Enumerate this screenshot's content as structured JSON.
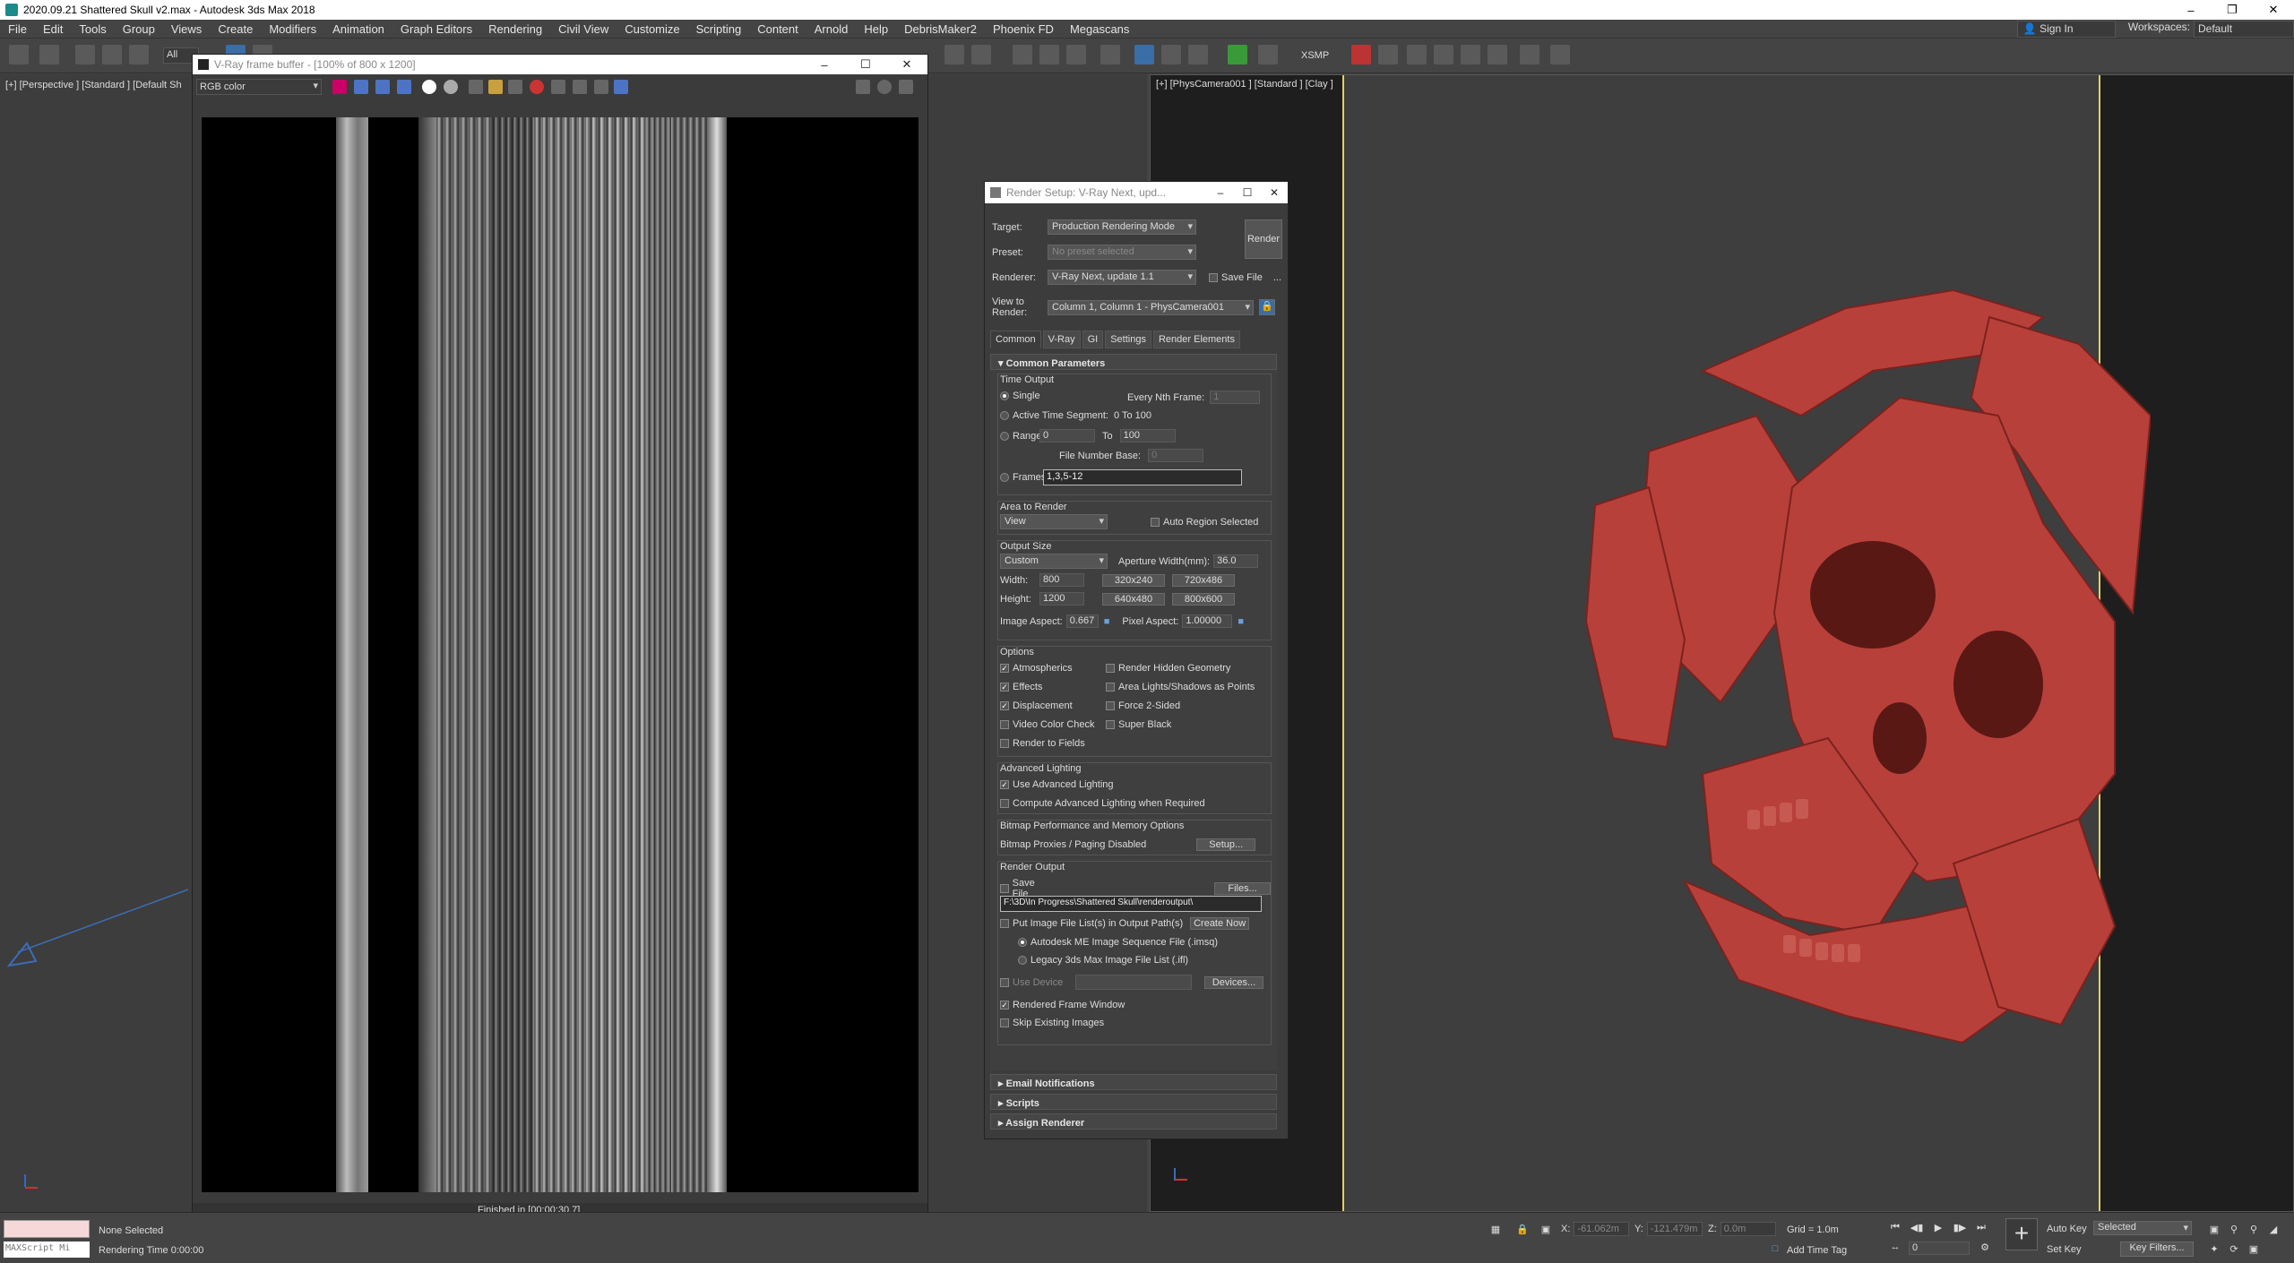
{
  "window": {
    "title": "2020.09.21 Shattered Skull v2.max - Autodesk 3ds Max 2018"
  },
  "menu": [
    "File",
    "Edit",
    "Tools",
    "Group",
    "Views",
    "Create",
    "Modifiers",
    "Animation",
    "Graph Editors",
    "Rendering",
    "Civil View",
    "Customize",
    "Scripting",
    "Content",
    "Arnold",
    "Help",
    "DebrisMaker2",
    "Phoenix FD",
    "Megascans"
  ],
  "account": {
    "signin": "Sign In",
    "workspaces_label": "Workspaces:",
    "workspaces_value": "Default"
  },
  "toolbar": {
    "selection_filter": "All",
    "xsmp": "XSMP"
  },
  "viewports": {
    "left_label": "[+] [Perspective ] [Standard ] [Default Sh",
    "right_label": "[+] [PhysCamera001 ] [Standard ] [Clay ]"
  },
  "vfb": {
    "title": "V-Ray frame buffer - [100% of 800 x 1200]",
    "channel": "RGB color",
    "status": "Finished in [00:00:30.7]"
  },
  "render_setup": {
    "title": "Render Setup: V-Ray Next, upd...",
    "target_label": "Target:",
    "target_value": "Production Rendering Mode",
    "preset_label": "Preset:",
    "preset_value": "No preset selected",
    "renderer_label": "Renderer:",
    "renderer_value": "V-Ray Next, update 1.1",
    "save_file": "Save File",
    "more": "...",
    "view_label": "View to\nRender:",
    "view_value": "Column 1, Column 1 - PhysCamera001",
    "render_button": "Render",
    "tabs": [
      "Common",
      "V-Ray",
      "GI",
      "Settings",
      "Render Elements"
    ],
    "common_params": "Common Parameters",
    "time_output": "Time Output",
    "single": "Single",
    "every_nth": "Every Nth Frame:",
    "every_nth_value": "1",
    "active_segment": "Active Time Segment:",
    "active_segment_value": "0 To 100",
    "range": "Range:",
    "range_from": "0",
    "range_to_label": "To",
    "range_to": "100",
    "file_number_base": "File Number Base:",
    "file_number_base_value": "0",
    "frames": "Frames",
    "frames_value": "1,3,5-12",
    "area_to_render": "Area to Render",
    "area_value": "View",
    "auto_region": "Auto Region Selected",
    "output_size": "Output Size",
    "output_preset": "Custom",
    "aperture_label": "Aperture Width(mm):",
    "aperture_value": "36.0",
    "width_label": "Width:",
    "width_value": "800",
    "height_label": "Height:",
    "height_value": "1200",
    "size_presets": [
      "320x240",
      "720x486",
      "640x480",
      "800x600"
    ],
    "image_aspect_label": "Image Aspect:",
    "image_aspect_value": "0.667",
    "pixel_aspect_label": "Pixel Aspect:",
    "pixel_aspect_value": "1.00000",
    "options": "Options",
    "opt_atmospherics": "Atmospherics",
    "opt_render_hidden": "Render Hidden Geometry",
    "opt_effects": "Effects",
    "opt_area_lights": "Area Lights/Shadows as Points",
    "opt_displacement": "Displacement",
    "opt_force2": "Force 2-Sided",
    "opt_video_color": "Video Color Check",
    "opt_super_black": "Super Black",
    "opt_render_fields": "Render to Fields",
    "adv_lighting": "Advanced Lighting",
    "use_adv_lighting": "Use Advanced Lighting",
    "compute_adv_lighting": "Compute Advanced Lighting when Required",
    "bitmap_perf": "Bitmap Performance and Memory Options",
    "bitmap_proxies": "Bitmap Proxies / Paging Disabled",
    "setup_button": "Setup...",
    "render_output": "Render Output",
    "ro_save_file": "Save File",
    "files_button": "Files...",
    "output_path": "F:\\3D\\In Progress\\Shattered Skull\\renderoutput\\",
    "put_image_list": "Put Image File List(s) in Output Path(s)",
    "create_now": "Create Now",
    "imsq": "Autodesk ME Image Sequence File (.imsq)",
    "ifl": "Legacy 3ds Max Image File List (.ifl)",
    "use_device": "Use Device",
    "devices_button": "Devices...",
    "rendered_frame_window": "Rendered Frame Window",
    "skip_existing": "Skip Existing Images",
    "email": "Email Notifications",
    "scripts": "Scripts",
    "assign_renderer": "Assign Renderer"
  },
  "status": {
    "maxscript": "MAXScript Mi",
    "selection": "None Selected",
    "rendering_time": "Rendering Time  0:00:00",
    "x_label": "X:",
    "x_value": "-61.062m",
    "y_label": "Y:",
    "y_value": "-121.479m",
    "z_label": "Z:",
    "z_value": "0.0m",
    "grid": "Grid = 1.0m",
    "add_time_tag": "Add Time Tag",
    "frame_value": "0",
    "auto_key": "Auto Key",
    "set_key": "Set Key",
    "selected": "Selected",
    "key_filters": "Key Filters..."
  },
  "colors": {
    "skull": "#b8403a",
    "camera_frame": "#e8d05a",
    "accent_blue": "#3b6da6"
  }
}
